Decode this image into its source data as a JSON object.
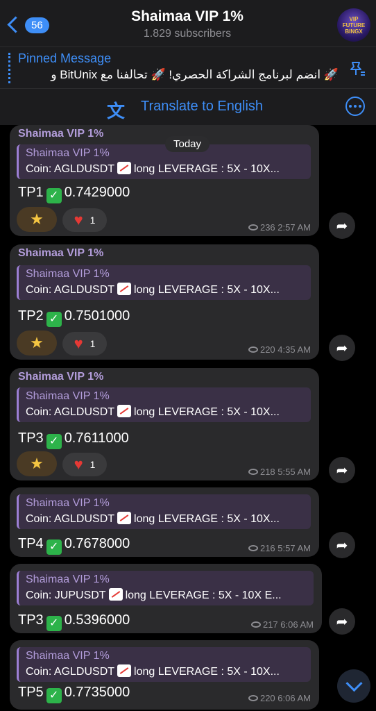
{
  "header": {
    "back_count": "56",
    "title": "Shaimaa VIP 1%",
    "subtitle": "1.829 subscribers",
    "avatar_lines": [
      "VIP",
      "FUTURE",
      "BINGX"
    ]
  },
  "pinned": {
    "title": "Pinned Message",
    "text": "🚀 انضم لبرنامج الشراكة الحصري! 🚀 تحالفنا مع BitUnix و"
  },
  "translate": {
    "label": "Translate to English",
    "icon": "translate-icon"
  },
  "chat": {
    "date_badge": "Today",
    "messages": [
      {
        "sender": "Shaimaa VIP 1%",
        "reply_sender": "Shaimaa VIP 1%",
        "reply_text_a": "Coin: AGLDUSDT",
        "reply_text_b": "long LEVERAGE : 5X - 10X...",
        "tp_label": "TP1",
        "tp_value": "0.7429000",
        "views": "236",
        "time": "2:57 AM",
        "heart_count": "1"
      },
      {
        "sender": "Shaimaa VIP 1%",
        "reply_sender": "Shaimaa VIP 1%",
        "reply_text_a": "Coin: AGLDUSDT",
        "reply_text_b": "long LEVERAGE : 5X - 10X...",
        "tp_label": "TP2",
        "tp_value": "0.7501000",
        "views": "220",
        "time": "4:35 AM",
        "heart_count": "1"
      },
      {
        "sender": "Shaimaa VIP 1%",
        "reply_sender": "Shaimaa VIP 1%",
        "reply_text_a": "Coin: AGLDUSDT",
        "reply_text_b": "long LEVERAGE : 5X - 10X...",
        "tp_label": "TP3",
        "tp_value": "0.7611000",
        "views": "218",
        "time": "5:55 AM",
        "heart_count": "1"
      },
      {
        "reply_sender": "Shaimaa VIP 1%",
        "reply_text_a": "Coin: AGLDUSDT",
        "reply_text_b": "long LEVERAGE : 5X - 10X...",
        "tp_label": "TP4",
        "tp_value": "0.7678000",
        "views": "216",
        "time": "5:57 AM"
      },
      {
        "reply_sender": "Shaimaa VIP 1%",
        "reply_text_a": "Coin: JUPUSDT",
        "reply_text_b": "long LEVERAGE : 5X - 10X E...",
        "tp_label": "TP3",
        "tp_value": "0.5396000",
        "views": "217",
        "time": "6:06 AM"
      },
      {
        "reply_sender": "Shaimaa VIP 1%",
        "reply_text_a": "Coin: AGLDUSDT",
        "reply_text_b": "long LEVERAGE : 5X - 10X...",
        "tp_label": "TP5",
        "tp_value": "0.7735000",
        "views": "220",
        "time": "6:06 AM"
      }
    ]
  },
  "colors": {
    "accent": "#3e8ef7",
    "sender": "#b39ddb",
    "bubble": "#2a2a2c",
    "check": "#2db34a",
    "heart": "#e53935"
  }
}
